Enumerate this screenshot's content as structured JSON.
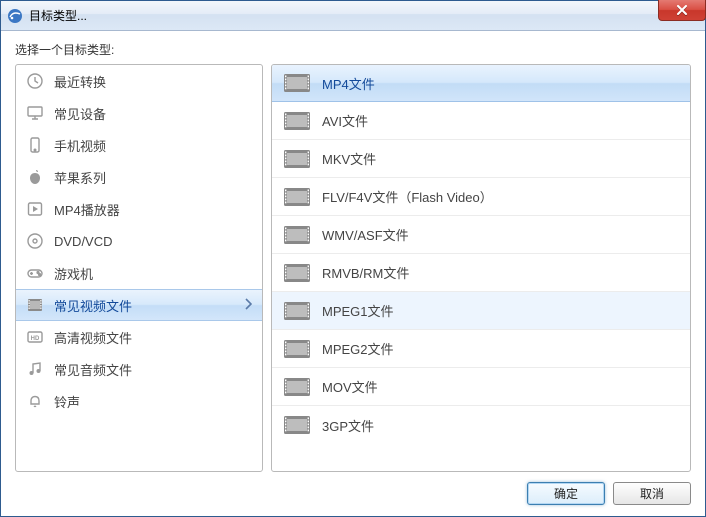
{
  "window": {
    "title": "目标类型..."
  },
  "prompt": "选择一个目标类型:",
  "categories": [
    {
      "icon": "clock",
      "label": "最近转换"
    },
    {
      "icon": "monitor",
      "label": "常见设备"
    },
    {
      "icon": "phone",
      "label": "手机视频"
    },
    {
      "icon": "apple",
      "label": "苹果系列"
    },
    {
      "icon": "player",
      "label": "MP4播放器"
    },
    {
      "icon": "disc",
      "label": "DVD/VCD"
    },
    {
      "icon": "gamepad",
      "label": "游戏机"
    },
    {
      "icon": "film",
      "label": "常见视频文件",
      "selected": true
    },
    {
      "icon": "hd",
      "label": "高清视频文件"
    },
    {
      "icon": "music",
      "label": "常见音频文件"
    },
    {
      "icon": "bell",
      "label": "铃声"
    }
  ],
  "formats": [
    {
      "label": "MP4文件",
      "selected": true
    },
    {
      "label": "AVI文件"
    },
    {
      "label": "MKV文件"
    },
    {
      "label": "FLV/F4V文件（Flash Video）"
    },
    {
      "label": "WMV/ASF文件"
    },
    {
      "label": "RMVB/RM文件"
    },
    {
      "label": "MPEG1文件",
      "hover": true
    },
    {
      "label": "MPEG2文件"
    },
    {
      "label": "MOV文件"
    },
    {
      "label": "3GP文件"
    }
  ],
  "buttons": {
    "ok": "确定",
    "cancel": "取消"
  }
}
